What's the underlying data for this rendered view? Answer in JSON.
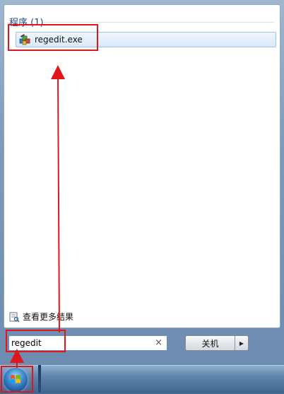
{
  "results": {
    "section_title": "程序 (1)",
    "items": [
      {
        "label": "regedit.exe",
        "icon": "registry-editor-icon"
      }
    ],
    "see_more": "查看更多结果"
  },
  "search": {
    "value": "regedit",
    "clear_glyph": "×"
  },
  "shutdown": {
    "label": "关机",
    "arrow_glyph": "▶"
  },
  "taskbar": {
    "start_icon": "windows-start-orb-icon"
  },
  "colors": {
    "annotation": "#e0161b",
    "header_text": "#1e4b86",
    "selection_bg": "#dbe9f8",
    "taskbar": "#4a6f96"
  }
}
